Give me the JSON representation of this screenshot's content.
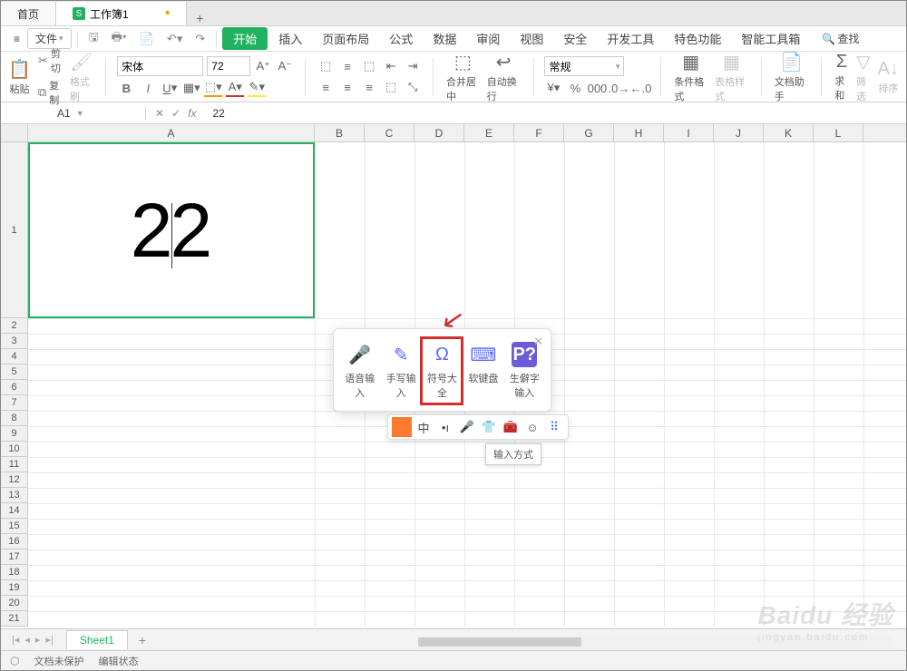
{
  "tabs": {
    "home": "首页",
    "workbook": "工作簿1"
  },
  "menu": {
    "file": "文件",
    "items": [
      "开始",
      "插入",
      "页面布局",
      "公式",
      "数据",
      "审阅",
      "视图",
      "安全",
      "开发工具",
      "特色功能",
      "智能工具箱"
    ],
    "search": "查找"
  },
  "ribbon": {
    "paste": "粘贴",
    "cut": "剪切",
    "copy": "复制",
    "fmtpaint": "格式刷",
    "font_name": "宋体",
    "font_size": "72",
    "merge": "合并居中",
    "wrap": "自动换行",
    "numfmt": "常规",
    "condfmt": "条件格式",
    "tablestyle": "表格样式",
    "dochelper": "文档助手",
    "sum": "求和",
    "filter": "筛选",
    "sort": "排序"
  },
  "fx": {
    "cell": "A1",
    "value": "22"
  },
  "cols": [
    "A",
    "B",
    "C",
    "D",
    "E",
    "F",
    "G",
    "H",
    "I",
    "J",
    "K",
    "L"
  ],
  "cell_value": "22",
  "ime": {
    "items": [
      "语音输入",
      "手写输入",
      "符号大全",
      "软键盘",
      "生僻字输入"
    ],
    "tooltip": "输入方式",
    "bar_zh": "中"
  },
  "sheet": {
    "name": "Sheet1"
  },
  "status": {
    "protect": "文档未保护",
    "edit": "编辑状态"
  },
  "watermark": {
    "brand": "Baidu 经验",
    "url": "jingyan.baidu.com"
  }
}
